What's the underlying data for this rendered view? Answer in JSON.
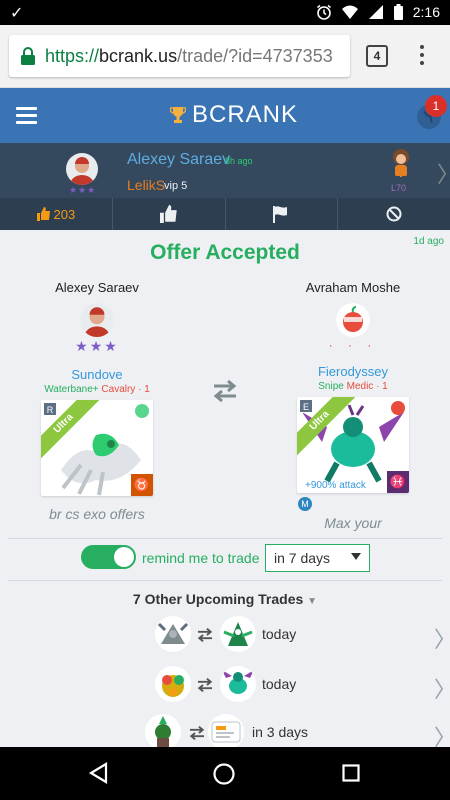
{
  "status_bar": {
    "left_icon": "check-icon",
    "time": "2:16"
  },
  "browser": {
    "url_scheme": "https://",
    "url_host": "bcrank.us",
    "url_path": "/trade/?id=4737353",
    "tab_count": "4"
  },
  "header": {
    "brand": "BCRANK",
    "notification_count": "1"
  },
  "user_bar": {
    "name": "Alexey Saraev",
    "time": "8h ago",
    "referral": "LelikS",
    "vip": "vip 5",
    "stars": "★★★",
    "level": "L70"
  },
  "actions": {
    "likes": "203"
  },
  "offer": {
    "title": "Offer Accepted",
    "age": "1d ago",
    "left": {
      "player": "Alexey Saraev",
      "stars": "★★★",
      "monster": "Sundove",
      "trait_a": "Waterbane+",
      "trait_b": "Cavalry · 1",
      "rank_letter": "R",
      "rarity": "Ultra",
      "zodiac": "♉",
      "note": "br cs exo offers"
    },
    "right": {
      "player": "Avraham Moshe",
      "dots": "· · ·",
      "monster": "Fierodyssey",
      "trait_a": "Snipe",
      "trait_b": "Medic · 1",
      "rank_letter": "E",
      "rarity": "Ultra",
      "zodiac": "♓",
      "boost": "+900% attack",
      "badge": "M",
      "note": "Max your"
    }
  },
  "remind": {
    "label": "remind me to trade",
    "selected": "in 7 days",
    "enabled": true
  },
  "upcoming": {
    "title": "7 Other Upcoming Trades",
    "rows": [
      {
        "when": "today"
      },
      {
        "when": "today"
      },
      {
        "when": "in 3 days"
      }
    ]
  },
  "colors": {
    "accent_green": "#27ae60",
    "header_blue": "#3a74b4",
    "user_bar": "#34495e",
    "action_bar": "#2c3e50"
  }
}
